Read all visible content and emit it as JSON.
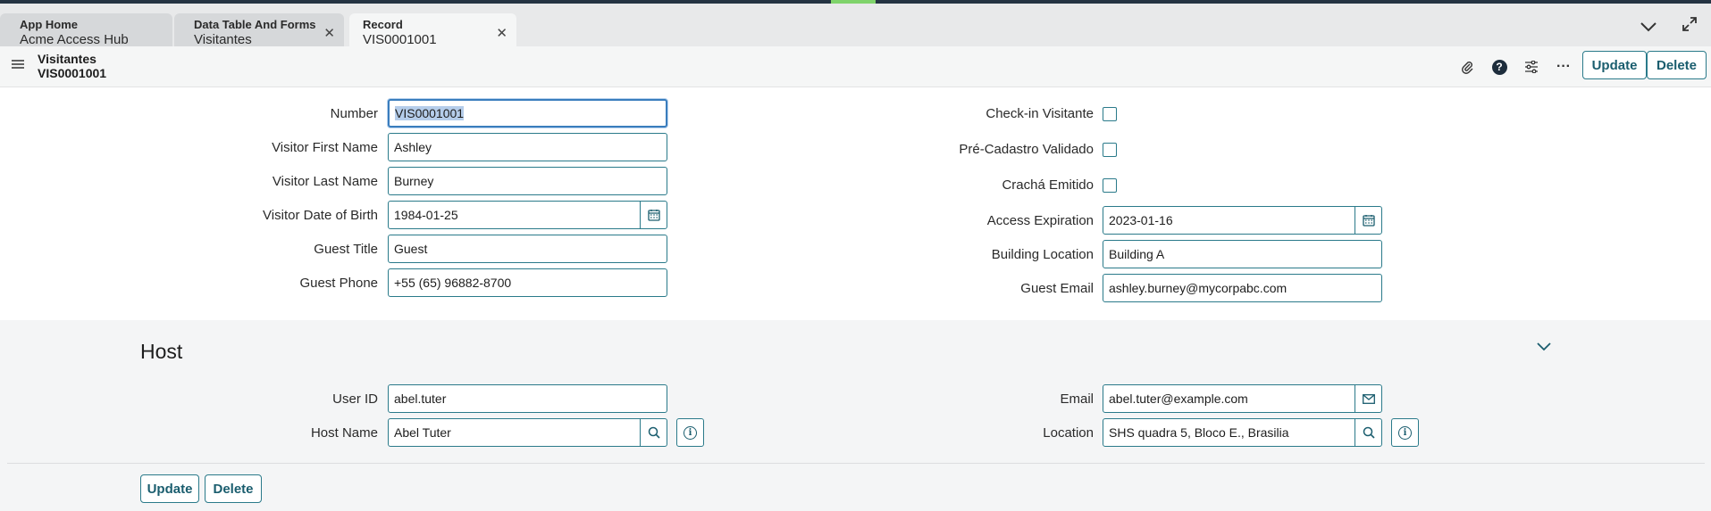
{
  "tabs": [
    {
      "title": "App Home",
      "subtitle": "Acme Access Hub"
    },
    {
      "title": "Data Table And Forms",
      "subtitle": "Visitantes"
    },
    {
      "title": "Record",
      "subtitle": "VIS0001001"
    }
  ],
  "header": {
    "table_name": "Visitantes",
    "record_number": "VIS0001001",
    "update_label": "Update",
    "delete_label": "Delete",
    "icons": [
      "paperclip-icon",
      "help-icon",
      "settings-sliders-icon",
      "more-icon"
    ]
  },
  "form": {
    "number": {
      "label": "Number",
      "value": "VIS0001001"
    },
    "first_name": {
      "label": "Visitor First Name",
      "value": "Ashley"
    },
    "last_name": {
      "label": "Visitor Last Name",
      "value": "Burney"
    },
    "dob": {
      "label": "Visitor Date of Birth",
      "value": "1984-01-25"
    },
    "guest_title": {
      "label": "Guest Title",
      "value": "Guest"
    },
    "guest_phone": {
      "label": "Guest Phone",
      "value": "+55 (65) 96882-8700"
    },
    "checkin": {
      "label": "Check-in Visitante",
      "checked": false
    },
    "precadastro": {
      "label": "Pré-Cadastro Validado",
      "checked": false
    },
    "cracha": {
      "label": "Crachá Emitido",
      "checked": false
    },
    "access_expiration": {
      "label": "Access Expiration",
      "value": "2023-01-16"
    },
    "building_location": {
      "label": "Building Location",
      "value": "Building A"
    },
    "guest_email": {
      "label": "Guest Email",
      "value": "ashley.burney@mycorpabc.com"
    }
  },
  "host": {
    "section_title": "Host",
    "user_id": {
      "label": "User ID",
      "value": "abel.tuter"
    },
    "host_name": {
      "label": "Host Name",
      "value": "Abel Tuter"
    },
    "email": {
      "label": "Email",
      "value": "abel.tuter@example.com"
    },
    "location": {
      "label": "Location",
      "value": "SHS quadra 5, Bloco E., Brasilia"
    }
  },
  "footer": {
    "update_label": "Update",
    "delete_label": "Delete"
  },
  "colors": {
    "accent": "#2a7a8a",
    "topbar": "#243342",
    "topbar_highlight": "#7fd36b",
    "focus": "#3a7dbd"
  }
}
